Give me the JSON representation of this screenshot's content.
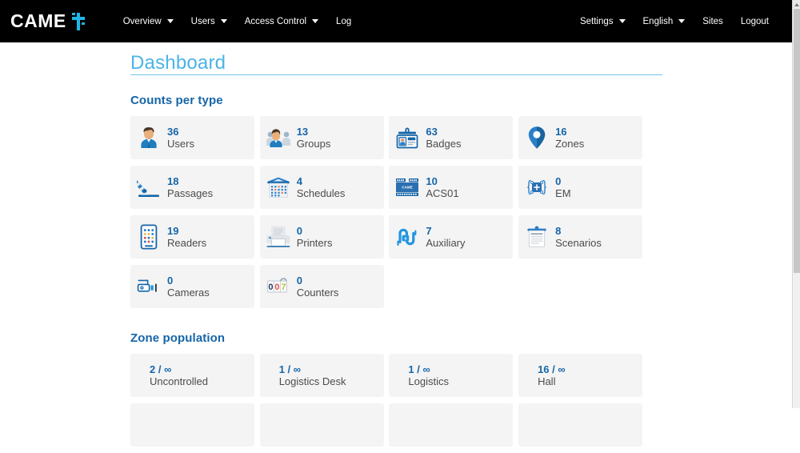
{
  "navbar": {
    "brand": "CAME",
    "brand_mark_icon": "came-cross-icon",
    "left_items": [
      {
        "label": "Overview",
        "icon": "chevron-down-icon",
        "has_caret": true
      },
      {
        "label": "Users",
        "icon": "chevron-down-icon",
        "has_caret": true
      },
      {
        "label": "Access Control",
        "icon": "chevron-down-icon",
        "has_caret": true
      },
      {
        "label": "Log",
        "has_caret": false
      }
    ],
    "right_items": [
      {
        "label": "Settings",
        "icon": "chevron-down-icon",
        "has_caret": true
      },
      {
        "label": "English",
        "icon": "chevron-down-icon",
        "has_caret": true
      },
      {
        "label": "Sites",
        "has_caret": false
      },
      {
        "label": "Logout",
        "has_caret": false
      }
    ],
    "background_color": "#000000",
    "accent_color": "#1fb6e8"
  },
  "page": {
    "title": "Dashboard",
    "title_color": "#4ab4e6"
  },
  "sections": {
    "counts": {
      "title": "Counts per type",
      "cards": [
        {
          "value": "36",
          "label": "Users",
          "icon": "user-icon"
        },
        {
          "value": "13",
          "label": "Groups",
          "icon": "users-group-icon"
        },
        {
          "value": "63",
          "label": "Badges",
          "icon": "badge-card-icon"
        },
        {
          "value": "16",
          "label": "Zones",
          "icon": "map-pin-icon"
        },
        {
          "value": "18",
          "label": "Passages",
          "icon": "barrier-gate-icon"
        },
        {
          "value": "4",
          "label": "Schedules",
          "icon": "calendar-icon"
        },
        {
          "value": "10",
          "label": "ACS01",
          "icon": "controller-device-icon"
        },
        {
          "value": "0",
          "label": "EM",
          "icon": "expansion-module-icon"
        },
        {
          "value": "19",
          "label": "Readers",
          "icon": "keypad-reader-icon"
        },
        {
          "value": "0",
          "label": "Printers",
          "icon": "printer-icon"
        },
        {
          "value": "7",
          "label": "Auxiliary",
          "icon": "cable-plug-icon"
        },
        {
          "value": "8",
          "label": "Scenarios",
          "icon": "clipboard-icon"
        },
        {
          "value": "0",
          "label": "Cameras",
          "icon": "cctv-camera-icon"
        },
        {
          "value": "0",
          "label": "Counters",
          "icon": "counter-digits-icon"
        }
      ]
    },
    "zones": {
      "title": "Zone population",
      "cards": [
        {
          "value": "2 / ∞",
          "label": "Uncontrolled"
        },
        {
          "value": "1 / ∞",
          "label": "Logistics Desk"
        },
        {
          "value": "1 / ∞",
          "label": "Logistics"
        },
        {
          "value": "16 / ∞",
          "label": "Hall"
        },
        {
          "value": "",
          "label": ""
        },
        {
          "value": "",
          "label": ""
        },
        {
          "value": "",
          "label": ""
        },
        {
          "value": "",
          "label": ""
        }
      ]
    }
  },
  "scrollbar": {
    "up_arrow_icon": "scroll-up-arrow-icon"
  }
}
